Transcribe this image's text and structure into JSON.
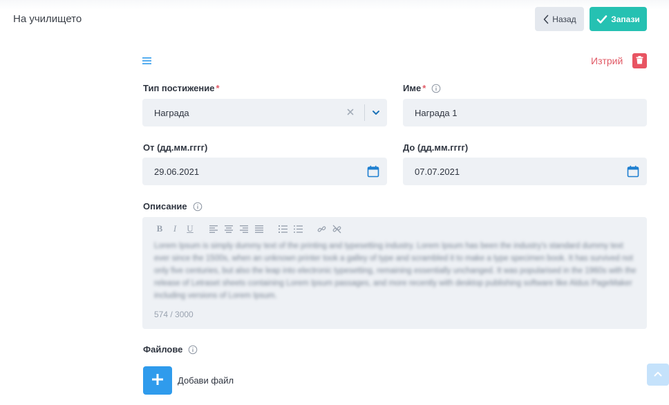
{
  "header": {
    "title": "На училището",
    "back_label": "Назад",
    "save_label": "Запази"
  },
  "form": {
    "delete_label": "Изтрий",
    "type": {
      "label": "Тип постижение",
      "required_mark": "*",
      "value": "Награда"
    },
    "name": {
      "label": "Име",
      "required_mark": "*",
      "value": "Награда 1"
    },
    "from": {
      "label": "От (дд.мм.гггг)",
      "value": "29.06.2021"
    },
    "to": {
      "label": "До (дд.мм.гггг)",
      "value": "07.07.2021"
    },
    "description": {
      "label": "Описание",
      "text": "Lorem Ipsum is simply dummy text of the printing and typesetting industry. Lorem Ipsum has been the industry's standard dummy text ever since the 1500s, when an unknown printer took a galley of type and scrambled it to make a type specimen book. It has survived not only five centuries, but also the leap into electronic typesetting, remaining essentially unchanged. It was popularised in the 1960s with the release of Letraset sheets containing Lorem Ipsum passages, and more recently with desktop publishing software like Aldus PageMaker including versions of Lorem Ipsum.",
      "counter": "574 / 3000"
    },
    "files": {
      "label": "Файлове",
      "add_label": "Добави файл"
    }
  },
  "colors": {
    "accent_teal": "#25c1b2",
    "accent_blue": "#2f9bec",
    "danger": "#e85462",
    "field_bg": "#eef1f5"
  }
}
